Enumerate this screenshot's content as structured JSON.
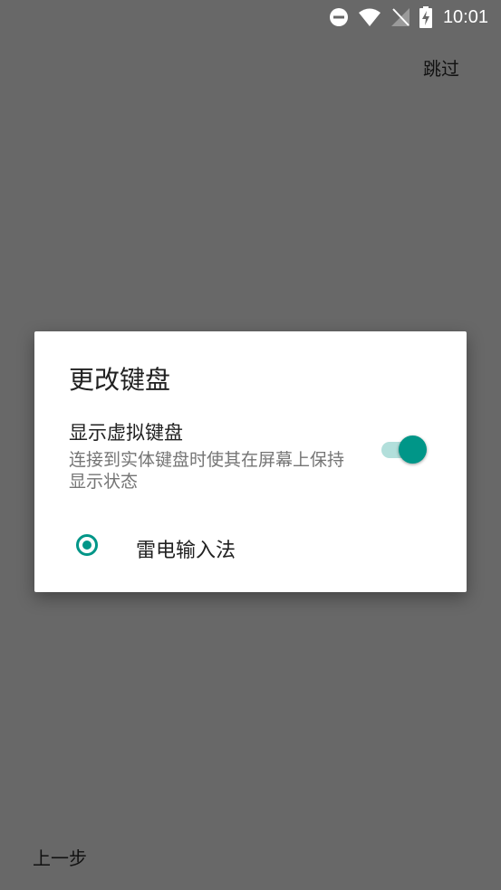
{
  "status_bar": {
    "time": "10:01",
    "icons": [
      "do-not-disturb-icon",
      "wifi-icon",
      "no-signal-icon",
      "battery-charging-icon"
    ]
  },
  "top_bar": {
    "skip_label": "跳过"
  },
  "dialog": {
    "title": "更改键盘",
    "show_virtual_keyboard": {
      "title": "显示虚拟键盘",
      "description": "连接到实体键盘时使其在屏幕上保持显示状态",
      "enabled": true
    },
    "input_methods": [
      {
        "label": "雷电输入法",
        "selected": true
      }
    ]
  },
  "bottom_bar": {
    "back_label": "上一步"
  },
  "colors": {
    "accent": "#009688",
    "accent_light": "#b2dfdb",
    "scrim_background": "#686868",
    "dialog_background": "#ffffff",
    "primary_text": "#212121",
    "secondary_text": "#757575"
  }
}
